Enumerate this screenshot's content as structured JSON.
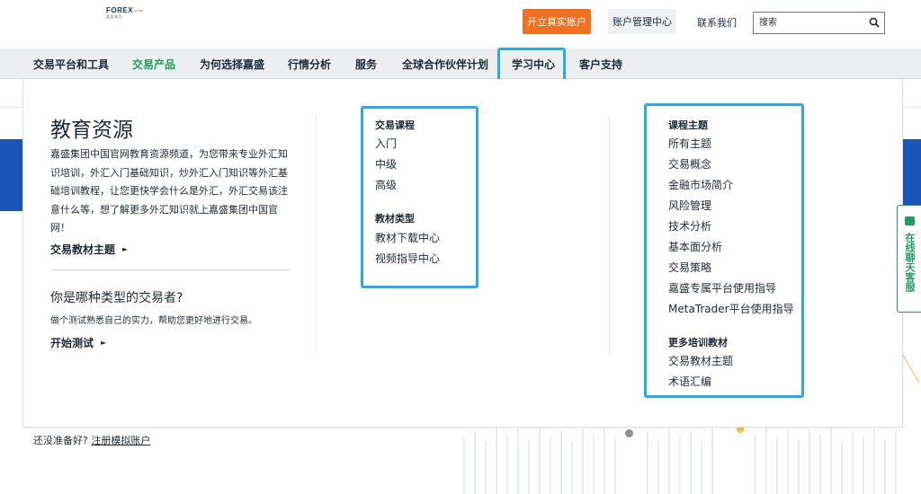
{
  "header": {
    "logo": {
      "main": "FOREX",
      "dot": ".com",
      "sub": "嘉盛集团"
    },
    "open_account_label": "开立真实账户",
    "account_center_label": "账户管理中心",
    "contact_label": "联系我们",
    "search_placeholder": "搜索"
  },
  "nav": {
    "items": [
      {
        "label": "交易平台和工具"
      },
      {
        "label": "交易产品"
      },
      {
        "label": "为何选择嘉盛"
      },
      {
        "label": "行情分析"
      },
      {
        "label": "服务"
      },
      {
        "label": "全球合作伙伴计划"
      },
      {
        "label": "学习中心"
      },
      {
        "label": "客户支持"
      }
    ]
  },
  "mega": {
    "title": "教育资源",
    "description": "嘉盛集团中国官网教育资源频道，为您带来专业外汇知识培训，外汇入门基础知识，炒外汇入门知识等外汇基础培训教程，让您更快学会什么是外汇，外汇交易该注意什么等，想了解更多外汇知识就上嘉盛集团中国官网！",
    "topics_link": "交易教材主题",
    "question": "你是哪种类型的交易者?",
    "question_desc": "做个测试熟悉自己的实力，帮助您更好地进行交易。",
    "start_test": "开始测试",
    "arrow": "►",
    "col2": {
      "head1": "交易课程",
      "items1": [
        "入门",
        "中级",
        "高级"
      ],
      "head2": "教材类型",
      "items2": [
        "教材下载中心",
        "视频指导中心"
      ]
    },
    "col3": {
      "head1": "课程主题",
      "items1": [
        "所有主题",
        "交易概念",
        "金融市场简介",
        "风险管理",
        "技术分析",
        "基本面分析",
        "交易策略",
        "嘉盛专属平台使用指导",
        "MetaTrader平台使用指导"
      ],
      "head2": "更多培训教材",
      "items2": [
        "交易教材主题",
        "术语汇编"
      ]
    }
  },
  "footer": {
    "ready_text": "还没准备好?",
    "demo_link": "注册模拟账户"
  },
  "chat": {
    "label": "在线聊天客服"
  },
  "colors": {
    "accent_orange": "#f37021",
    "brand_green": "#1e9e5a",
    "highlight_blue": "#29a9f2",
    "hero_blue": "#1a56b8"
  }
}
